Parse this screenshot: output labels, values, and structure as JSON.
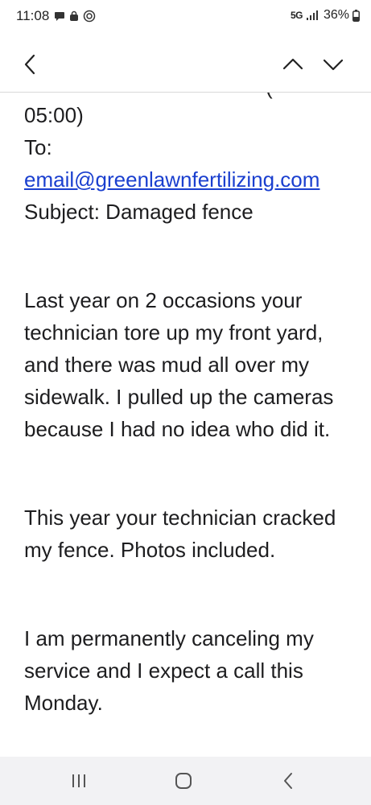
{
  "status_bar": {
    "time": "11:08",
    "network": "5G",
    "battery": "36%"
  },
  "toolbar": {
    "back_icon": "chevron-left-icon",
    "prev_icon": "chevron-up-icon",
    "next_icon": "chevron-down-icon"
  },
  "message": {
    "timezone_tail": "05:00)",
    "to_label": "To:",
    "to_email": "email@greenlawnfertilizing.com",
    "subject_line": "Subject: Damaged fence",
    "paragraphs": [
      "Last year on 2 occasions your technician tore up my front yard, and there was mud all over my sidewalk. I pulled up the cameras because I had no idea who did it.",
      "This year your technician cracked my fence. Photos included.",
      "I am permanently canceling my service and I expect a call this Monday."
    ]
  },
  "nav_bar": {
    "recent_icon": "recent-apps-icon",
    "home_icon": "home-icon",
    "back_icon": "back-icon"
  },
  "colors": {
    "link": "#1a3fcf",
    "text": "#1d1d1f",
    "nav_bg": "#f2f2f4"
  }
}
